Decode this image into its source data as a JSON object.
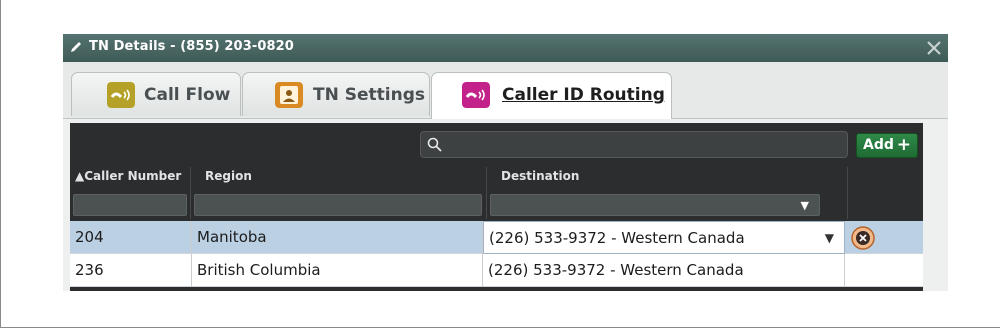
{
  "window": {
    "title": "TN Details - (855) 203-0820"
  },
  "tabs": [
    {
      "label": "Call Flow",
      "icon": "call-flow-icon",
      "color": "#b5a127"
    },
    {
      "label": "TN Settings",
      "icon": "tn-settings-icon",
      "color": "#d98a22"
    },
    {
      "label": "Caller ID Routing",
      "icon": "caller-id-routing-icon",
      "color": "#c2228a",
      "active": true
    }
  ],
  "toolbar": {
    "search_value": "",
    "add_label": "Add",
    "add_symbol": "+"
  },
  "columns": {
    "caller_number": "▲Caller Number",
    "region": "Region",
    "destination": "Destination"
  },
  "rows": [
    {
      "caller_number": "204",
      "region": "Manitoba",
      "destination": "(226) 533-9372 - Western Canada",
      "selected": true
    },
    {
      "caller_number": "236",
      "region": "British Columbia",
      "destination": "(226) 533-9372 - Western Canada",
      "selected": false
    }
  ],
  "colors": {
    "titlebar": "#4a6764",
    "grid_header": "#2b2d2e",
    "selected_row": "#bcd0e3",
    "add_button": "#2a7d40"
  }
}
